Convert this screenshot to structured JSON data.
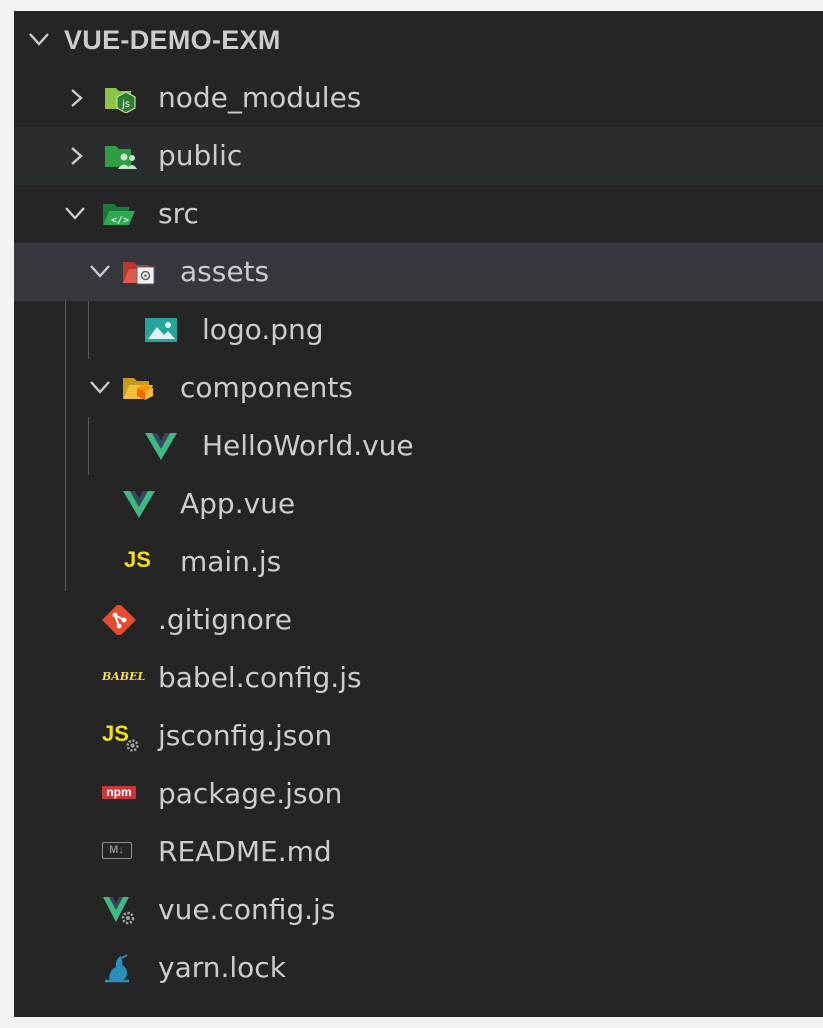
{
  "explorer": {
    "root_label": "VUE-DEMO-EXM",
    "items": [
      {
        "label": "node_modules",
        "icon": "nodejs-folder-icon"
      },
      {
        "label": "public",
        "icon": "public-folder-icon"
      },
      {
        "label": "src",
        "icon": "src-folder-icon"
      },
      {
        "label": "assets",
        "icon": "assets-folder-icon"
      },
      {
        "label": "logo.png",
        "icon": "image-file-icon"
      },
      {
        "label": "components",
        "icon": "components-folder-icon"
      },
      {
        "label": "HelloWorld.vue",
        "icon": "vue-file-icon"
      },
      {
        "label": "App.vue",
        "icon": "vue-file-icon"
      },
      {
        "label": "main.js",
        "icon": "javascript-file-icon",
        "icon_text": "JS"
      },
      {
        "label": ".gitignore",
        "icon": "git-icon"
      },
      {
        "label": "babel.config.js",
        "icon": "babel-icon",
        "icon_text": "BABEL"
      },
      {
        "label": "jsconfig.json",
        "icon": "jsconfig-icon",
        "icon_text": "JS"
      },
      {
        "label": "package.json",
        "icon": "npm-icon",
        "icon_text": "npm"
      },
      {
        "label": "README.md",
        "icon": "markdown-icon",
        "icon_text": "M↓"
      },
      {
        "label": "vue.config.js",
        "icon": "vue-config-icon"
      },
      {
        "label": "yarn.lock",
        "icon": "yarn-icon"
      }
    ]
  },
  "colors": {
    "panel_bg": "#252526",
    "hover_row": "#2a2d2e",
    "selected_row": "#37373d",
    "text": "#cccccc",
    "vue_green": "#41b883",
    "js_yellow": "#f5de19",
    "git_red": "#e44c30",
    "npm_red": "#cb3837",
    "yarn_blue": "#2c8ebb"
  }
}
